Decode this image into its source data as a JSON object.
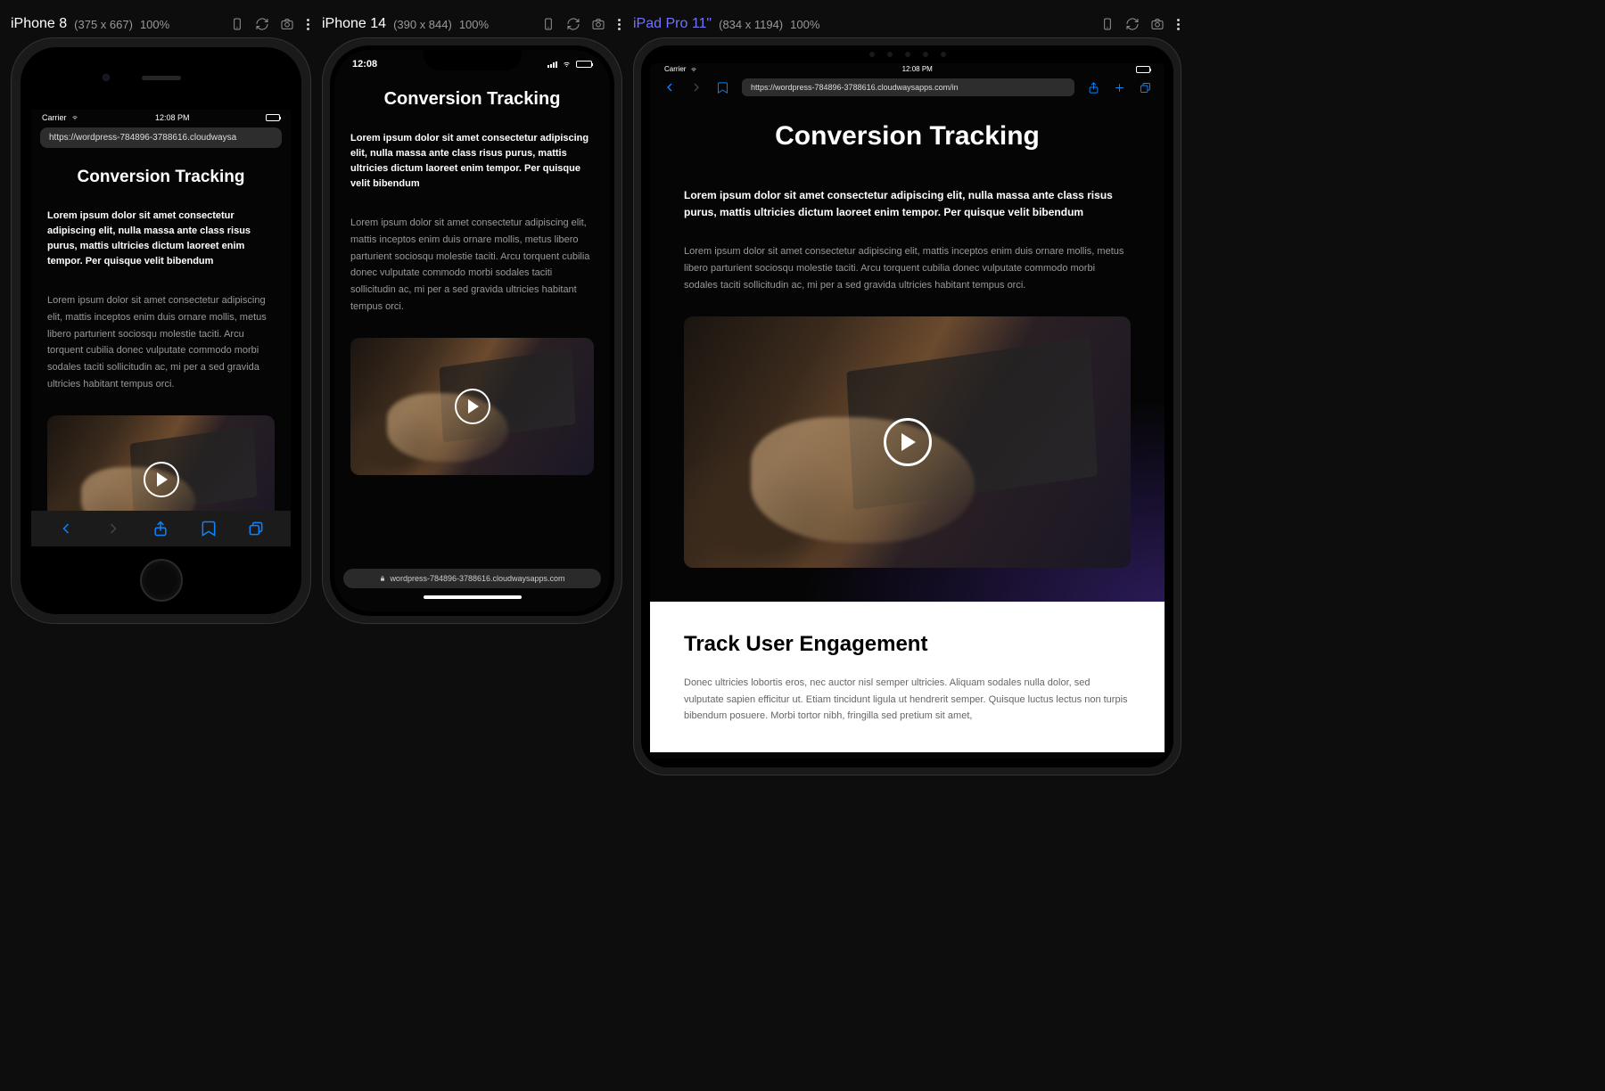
{
  "devices": {
    "iphone8": {
      "name": "iPhone 8",
      "dims": "(375 x 667)",
      "zoom": "100%"
    },
    "iphone14": {
      "name": "iPhone 14",
      "dims": "(390 x 844)",
      "zoom": "100%"
    },
    "ipad": {
      "name": "iPad Pro 11\"",
      "dims": "(834 x 1194)",
      "zoom": "100%"
    }
  },
  "status": {
    "carrier": "Carrier",
    "time12": "12:08 PM",
    "time24": "12:08"
  },
  "urls": {
    "full": "https://wordpress-784896-3788616.cloudwaysa",
    "ipad": "https://wordpress-784896-3788616.cloudwaysapps.com/in",
    "short": "wordpress-784896-3788616.cloudwaysapps.com"
  },
  "page": {
    "title": "Conversion Tracking",
    "lead": "Lorem ipsum dolor sit amet consectetur adipiscing elit, nulla massa ante class risus purus, mattis ultricies dictum laoreet enim tempor. Per quisque velit bibendum",
    "body": "Lorem ipsum dolor sit amet consectetur adipiscing elit, mattis inceptos enim duis ornare mollis, metus libero parturient sociosqu molestie taciti. Arcu torquent cubilia donec vulputate commodo morbi sodales taciti sollicitudin ac, mi per a sed gravida ultricies habitant tempus orci.",
    "section2_title": "Track User Engagement",
    "section2_body": "Donec ultricies lobortis eros, nec auctor nisl semper ultricies. Aliquam sodales nulla dolor, sed vulputate sapien efficitur ut. Etiam tincidunt ligula ut hendrerit semper. Quisque luctus lectus non turpis bibendum posuere. Morbi tortor nibh, fringilla sed pretium sit amet,"
  }
}
